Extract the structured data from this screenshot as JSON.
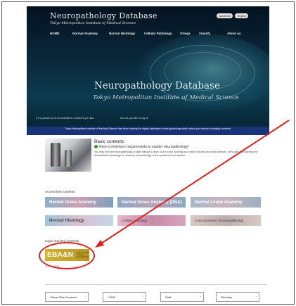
{
  "header": {
    "brand_name": "Neuropathology Database",
    "brand_sub": "Tokyo Metropolitan Institute of Medical Science",
    "lang_japanese": "Japanese",
    "lang_english": "English",
    "nav": [
      "HOME",
      "Normal Anatomy",
      "Normal Histology",
      "Cellular Pathology",
      "Ortega",
      "Zoonify",
      "About us"
    ],
    "hero_title": "Neuropathology Database",
    "hero_subtitle": "Tokyo Metropolitan Institute of Medical Science",
    "hero_note_left": "If it's please try to find whatever contents you like.",
    "hero_note_right": "Would you like to log in!",
    "bluebar_text": "Tokyo Metropolitan Institute of Medical Science has been making the digital database of neuropathology which offers you various educating contents."
  },
  "basic": {
    "title": "Basic contents",
    "subtitle": "Here is minimum requirements to master neuropathology!",
    "text": "You may feel that neuropathology a rather difficult to learn. Don't worry. Nothing is so hard if divided into small portions. Let's start with learning the fundamental knowledge on anatomy and pathology of the central nervous system."
  },
  "access": {
    "label": "Access free contents",
    "tiles": [
      "Normal Gross Anatomy",
      "Normal Gross Anatomy (DNA)",
      "Normal Loupe Anatomy",
      "Normal Histology",
      "Cellular pathology",
      "Core curriculum of neuropathology"
    ]
  },
  "login": {
    "label": "Login required contents",
    "eban_logo": "EBA&N",
    "eban_text": "Evidence Based Analysis & Neuropathology",
    "below": "Log in required"
  },
  "footer": [
    "Virtual Slide Contents",
    "LCMP",
    "Staff",
    "Site Map"
  ],
  "colors": {
    "header_bg": "#0a2a3d",
    "bluebar": "#19337a",
    "highlight": "#e02020",
    "eban_gold": "#d4b22a"
  }
}
